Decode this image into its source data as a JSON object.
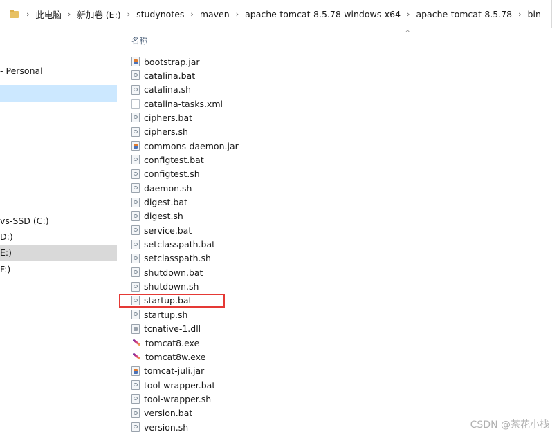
{
  "address_bar": {
    "crumbs": [
      "此电脑",
      "新加卷 (E:)",
      "studynotes",
      "maven",
      "apache-tomcat-8.5.78-windows-x64",
      "apache-tomcat-8.5.78",
      "bin"
    ]
  },
  "nav": {
    "items": [
      {
        "label": "- Personal",
        "state": "normal"
      },
      {
        "label": "",
        "state": "selected"
      },
      {
        "label": "vs-SSD (C:)",
        "state": "normal"
      },
      {
        "label": "D:)",
        "state": "normal"
      },
      {
        "label": "E:)",
        "state": "gray"
      },
      {
        "label": "F:)",
        "state": "normal"
      }
    ]
  },
  "list": {
    "column_header": "名称",
    "sort_indicator": "^",
    "files": [
      {
        "name": "bootstrap.jar",
        "icon": "jar-icon"
      },
      {
        "name": "catalina.bat",
        "icon": "bat-icon"
      },
      {
        "name": "catalina.sh",
        "icon": "bat-icon"
      },
      {
        "name": "catalina-tasks.xml",
        "icon": "xml-icon"
      },
      {
        "name": "ciphers.bat",
        "icon": "bat-icon"
      },
      {
        "name": "ciphers.sh",
        "icon": "bat-icon"
      },
      {
        "name": "commons-daemon.jar",
        "icon": "jar-icon"
      },
      {
        "name": "configtest.bat",
        "icon": "bat-icon"
      },
      {
        "name": "configtest.sh",
        "icon": "bat-icon"
      },
      {
        "name": "daemon.sh",
        "icon": "bat-icon"
      },
      {
        "name": "digest.bat",
        "icon": "bat-icon"
      },
      {
        "name": "digest.sh",
        "icon": "bat-icon"
      },
      {
        "name": "service.bat",
        "icon": "bat-icon"
      },
      {
        "name": "setclasspath.bat",
        "icon": "bat-icon"
      },
      {
        "name": "setclasspath.sh",
        "icon": "bat-icon"
      },
      {
        "name": "shutdown.bat",
        "icon": "bat-icon"
      },
      {
        "name": "shutdown.sh",
        "icon": "bat-icon"
      },
      {
        "name": "startup.bat",
        "icon": "bat-icon",
        "highlighted": true
      },
      {
        "name": "startup.sh",
        "icon": "bat-icon"
      },
      {
        "name": "tcnative-1.dll",
        "icon": "dll-icon"
      },
      {
        "name": "tomcat8.exe",
        "icon": "exe-icon"
      },
      {
        "name": "tomcat8w.exe",
        "icon": "exe-icon"
      },
      {
        "name": "tomcat-juli.jar",
        "icon": "jar-icon"
      },
      {
        "name": "tool-wrapper.bat",
        "icon": "bat-icon"
      },
      {
        "name": "tool-wrapper.sh",
        "icon": "bat-icon"
      },
      {
        "name": "version.bat",
        "icon": "bat-icon"
      },
      {
        "name": "version.sh",
        "icon": "bat-icon"
      }
    ]
  },
  "watermark": "CSDN @茶花小栈",
  "colors": {
    "highlight_border": "#e53935",
    "selected_bg": "#cce8ff",
    "header_text": "#4c607a"
  }
}
